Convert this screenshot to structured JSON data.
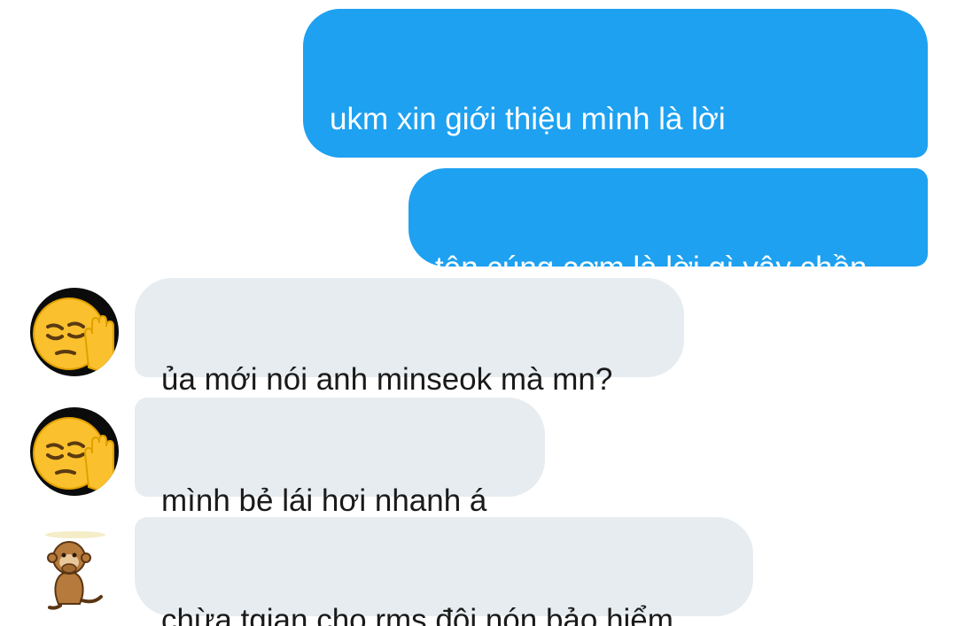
{
  "messages": [
    {
      "direction": "outgoing",
      "text": "ukm xin giới thiệu mình là lời\nwangho"
    },
    {
      "direction": "outgoing",
      "text": "tên cúng cơm là lời gì vậy chồn"
    },
    {
      "direction": "incoming",
      "text": "ủa mới nói anh minseok mà mn?",
      "avatar": "pensive-face-hand-icon"
    },
    {
      "direction": "incoming",
      "text": "mình bẻ lái hơi nhanh á",
      "avatar": "pensive-face-hand-icon"
    },
    {
      "direction": "incoming",
      "text": "chừa tgian cho rms đội nón bảo hiểm",
      "avatar": "monkey-sticker-icon"
    }
  ],
  "colors": {
    "outgoing_bubble": "#1ea1f1",
    "incoming_bubble": "#e6ecf0",
    "background": "#ffffff"
  }
}
